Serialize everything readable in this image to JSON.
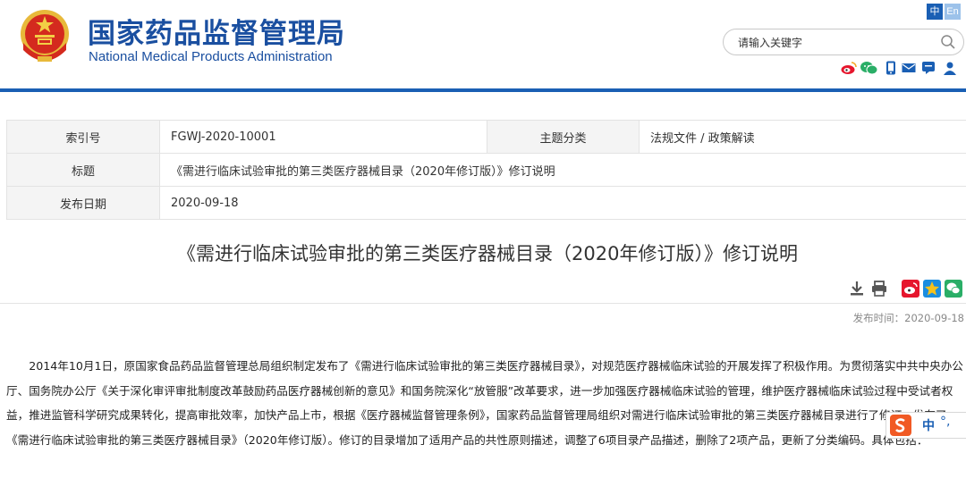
{
  "header": {
    "title_cn": "国家药品监督管理局",
    "title_en": "National Medical Products Administration",
    "lang_cn": "中",
    "lang_en": "En",
    "search_placeholder": "请输入关键字",
    "social_icons": [
      "weibo-icon",
      "wechat-icon",
      "mobile-icon",
      "mail-icon",
      "message-icon",
      "user-icon"
    ],
    "brand_color": "#1a5fb4"
  },
  "info_table": {
    "index_label": "索引号",
    "index_value": "FGWJ-2020-10001",
    "category_label": "主题分类",
    "category_value": "法规文件 / 政策解读",
    "title_label": "标题",
    "title_value": "《需进行临床试验审批的第三类医疗器械目录（2020年修订版）》修订说明",
    "date_label": "发布日期",
    "date_value": "2020-09-18"
  },
  "article": {
    "title": "《需进行临床试验审批的第三类医疗器械目录（2020年修订版）》修订说明",
    "publish_time": "发布时间：2020-09-18",
    "tool_icons": [
      "download-icon",
      "print-icon",
      "share-weibo-icon",
      "share-qzone-icon",
      "share-wechat-icon"
    ],
    "paragraph": "2014年10月1日，原国家食品药品监督管理总局组织制定发布了《需进行临床试验审批的第三类医疗器械目录》，对规范医疗器械临床试验的开展发挥了积极作用。为贯彻落实中共中央办公厅、国务院办公厅《关于深化审评审批制度改革鼓励药品医疗器械创新的意见》和国务院深化“放管服”改革要求，进一步加强医疗器械临床试验的管理，维护医疗器械临床试验过程中受试者权益，推进监管科学研究成果转化，提高审批效率，加快产品上市，根据《医疗器械监督管理条例》，国家药品监督管理局组织对需进行临床试验审批的第三类医疗器械目录进行了修订，发布了《需进行临床试验审批的第三类医疗器械目录》（2020年修订版）。修订的目录增加了适用产品的共性原则描述，调整了6项目录产品描述，删除了2项产品，更新了分类编码。具体包括："
  },
  "ime": {
    "icon": "sogou-icon",
    "mode": "中",
    "punct": "°,"
  }
}
